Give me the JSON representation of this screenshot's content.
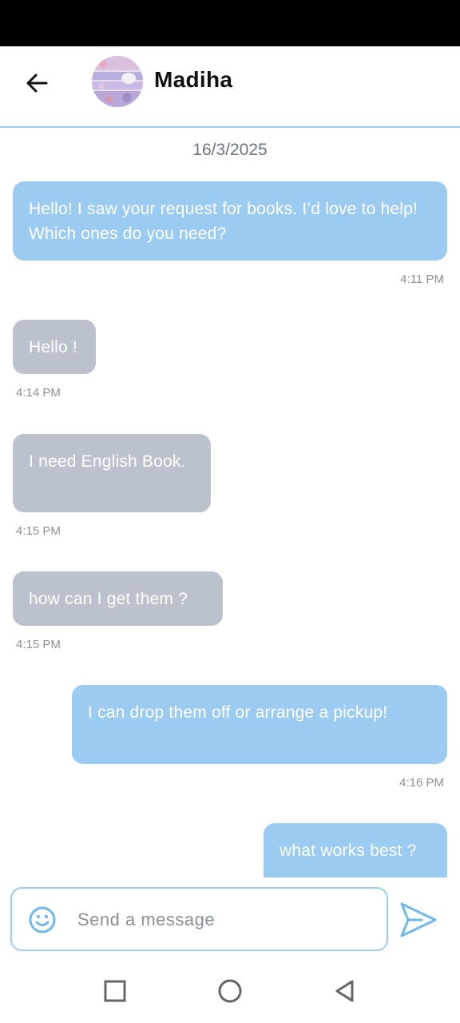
{
  "header": {
    "contact_name": "Madiha"
  },
  "chat": {
    "date": "16/3/2025",
    "messages": [
      {
        "direction": "sent",
        "text": "Hello! I saw your request for books. I’d love to help! Which ones do you need?",
        "time": "4:11 PM"
      },
      {
        "direction": "received",
        "text": "Hello !",
        "time": "4:14 PM"
      },
      {
        "direction": "received",
        "text": "I need English Book.",
        "time": "4:15 PM"
      },
      {
        "direction": "received",
        "text": "how can I get them ?",
        "time": "4:15 PM"
      },
      {
        "direction": "sent",
        "text": "I can drop them off or arrange a pickup!",
        "time": "4:16 PM"
      },
      {
        "direction": "sent",
        "text": "what works best ?",
        "time": ""
      }
    ]
  },
  "composer": {
    "placeholder": "Send a message"
  },
  "icons": {
    "back": "arrow-left-icon",
    "emoji": "smiley-icon",
    "send": "paper-plane-icon",
    "nav_recents": "square-icon",
    "nav_home": "circle-icon",
    "nav_back": "triangle-back-icon"
  },
  "colors": {
    "sent_bubble": "#9ccbf1",
    "received_bubble": "#bbc1cd",
    "accent": "#6fb8ea"
  }
}
